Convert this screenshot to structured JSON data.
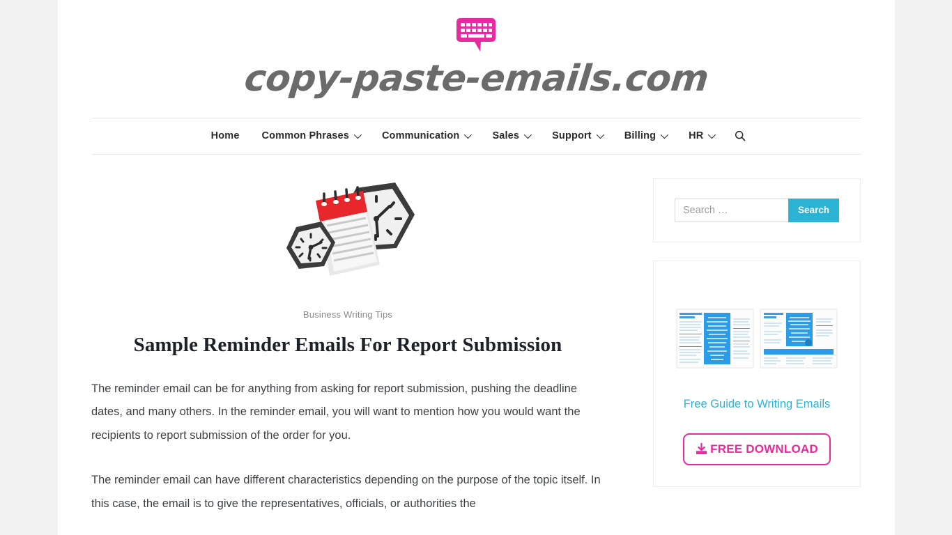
{
  "site": {
    "logo_text": "copy-paste-emails.com",
    "logo_icon": "keyboard-speech-bubble-icon"
  },
  "nav": {
    "items": [
      {
        "label": "Home",
        "has_dropdown": false
      },
      {
        "label": "Common Phrases",
        "has_dropdown": true
      },
      {
        "label": "Communication",
        "has_dropdown": true
      },
      {
        "label": "Sales",
        "has_dropdown": true
      },
      {
        "label": "Support",
        "has_dropdown": true
      },
      {
        "label": "Billing",
        "has_dropdown": true
      },
      {
        "label": "HR",
        "has_dropdown": true
      }
    ],
    "search_icon": "search-icon"
  },
  "article": {
    "featured_image": "clocks-and-calendar-illustration",
    "category": "Business Writing Tips",
    "title": "Sample Reminder Emails For Report Submission",
    "paragraphs": [
      "The reminder email can be for anything from asking for report submission, pushing the deadline dates, and many others. In the reminder email, you will want to mention how you would want the recipients to report submission of the order for you.",
      "The reminder email can have different characteristics depending on the purpose of the topic itself. In this case, the email is to give the representatives, officials, or authorities the"
    ]
  },
  "sidebar": {
    "search": {
      "placeholder": "Search …",
      "value": "",
      "button_label": "Search"
    },
    "promo": {
      "image_alt": "free-guide-preview-thumbnails",
      "link_label": "Free Guide to Writing Emails",
      "download_label": "FREE DOWNLOAD",
      "download_icon": "download-icon"
    }
  },
  "colors": {
    "accent_pink": "#e8299f",
    "accent_cyan": "#2cb3d4",
    "page_background": "#f2f2f2",
    "logo_gray": "#6b6b6b"
  }
}
